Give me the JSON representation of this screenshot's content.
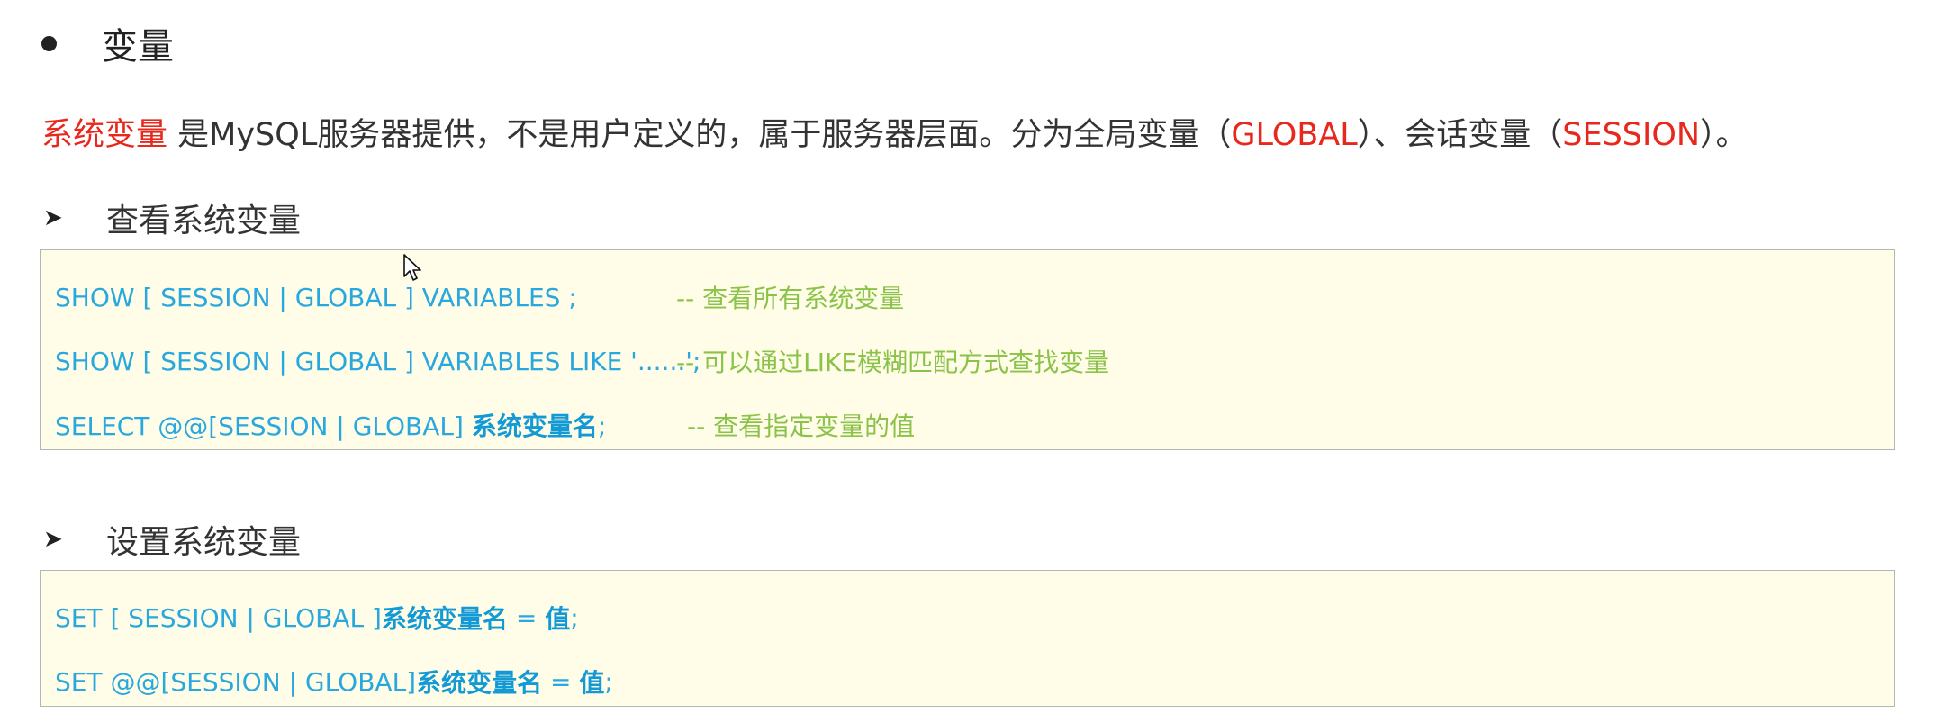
{
  "heading": {
    "bullet_icon": "bullet-dot-icon",
    "title": "变量"
  },
  "intro": {
    "term": "系统变量",
    "text1": " 是MySQL服务器提供，不是用户定义的，属于服务器层面。分为全局变量（",
    "global": "GLOBAL",
    "text2": "）、会话变量（",
    "session": "SESSION",
    "text3": "）。"
  },
  "section_view": {
    "arrow_icon": "arrow-right-icon",
    "title": "查看系统变量",
    "lines": [
      {
        "code": "SHOW  [ SESSION | GLOBAL ]   VARIABLES ;",
        "comment": "-- 查看所有系统变量"
      },
      {
        "code": "SHOW  [ SESSION | GLOBAL ]   VARIABLES  LIKE  '......';",
        "comment": "-- 可以通过LIKE模糊匹配方式查找变量"
      },
      {
        "code": "SELECT  @@[SESSION | GLOBAL]  ",
        "code_bold": "系统变量名",
        "code_tail": ";",
        "comment": "--  查看指定变量的值"
      }
    ]
  },
  "section_set": {
    "arrow_icon": "arrow-right-icon",
    "title": "设置系统变量",
    "lines": [
      {
        "code_pre": "SET  [ SESSION | GLOBAL ]   ",
        "bold1": "系统变量名",
        "mid": " = ",
        "bold2": "值",
        "tail": " ;"
      },
      {
        "code_pre": "SET  @@[SESSION | GLOBAL]",
        "bold1": "系统变量名",
        "mid": " = ",
        "bold2": "值",
        "tail": " ;"
      }
    ]
  },
  "cursor_icon": "mouse-pointer-icon"
}
